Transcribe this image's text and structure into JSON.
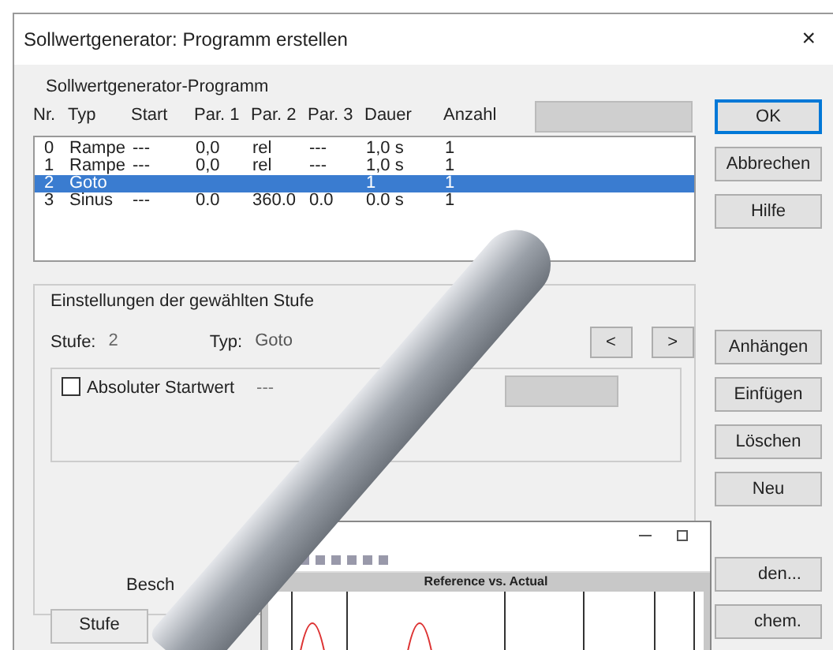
{
  "window": {
    "title": "Sollwertgenerator: Programm erstellen",
    "close": "×"
  },
  "program": {
    "label": "Sollwertgenerator-Programm",
    "columns": [
      "Nr.",
      "Typ",
      "Start",
      "Par. 1",
      "Par. 2",
      "Par. 3",
      "Dauer",
      "Anzahl"
    ],
    "rows": [
      {
        "cells": [
          "0",
          "Rampe",
          "---",
          "0,0",
          "rel",
          "---",
          "1,0 s",
          "1"
        ],
        "selected": false
      },
      {
        "cells": [
          "1",
          "Rampe",
          "---",
          "0,0",
          "rel",
          "---",
          "1,0 s",
          "1"
        ],
        "selected": false
      },
      {
        "cells": [
          "2",
          "Goto",
          "",
          "",
          "",
          "",
          "1",
          "1"
        ],
        "selected": true
      },
      {
        "cells": [
          "3",
          "Sinus",
          "---",
          "0.0",
          "360.0",
          "0.0",
          "0.0 s",
          "1"
        ],
        "selected": false
      }
    ]
  },
  "buttons": [
    {
      "label": "OK",
      "default": true
    },
    {
      "label": "Abbrechen",
      "default": false
    },
    {
      "label": "Hilfe",
      "default": false
    }
  ],
  "settings": {
    "label": "Einstellungen der gewählten Stufe",
    "stufe_label": "Stufe:",
    "stufe_value": "2",
    "typ_label": "Typ:",
    "typ_value": "Goto",
    "prev": "<",
    "next": ">",
    "absolute": {
      "label": "Absoluter Startwert",
      "checked": false,
      "value": "---"
    },
    "beschr_label": "Besch",
    "stufe_button": "Stufe"
  },
  "edit_buttons": [
    "Anhängen",
    "Einfügen",
    "Löschen",
    "Neu"
  ],
  "lower_buttons": [
    "den...",
    "chem."
  ],
  "inset": {
    "chart_title": "Reference vs. Actual"
  }
}
